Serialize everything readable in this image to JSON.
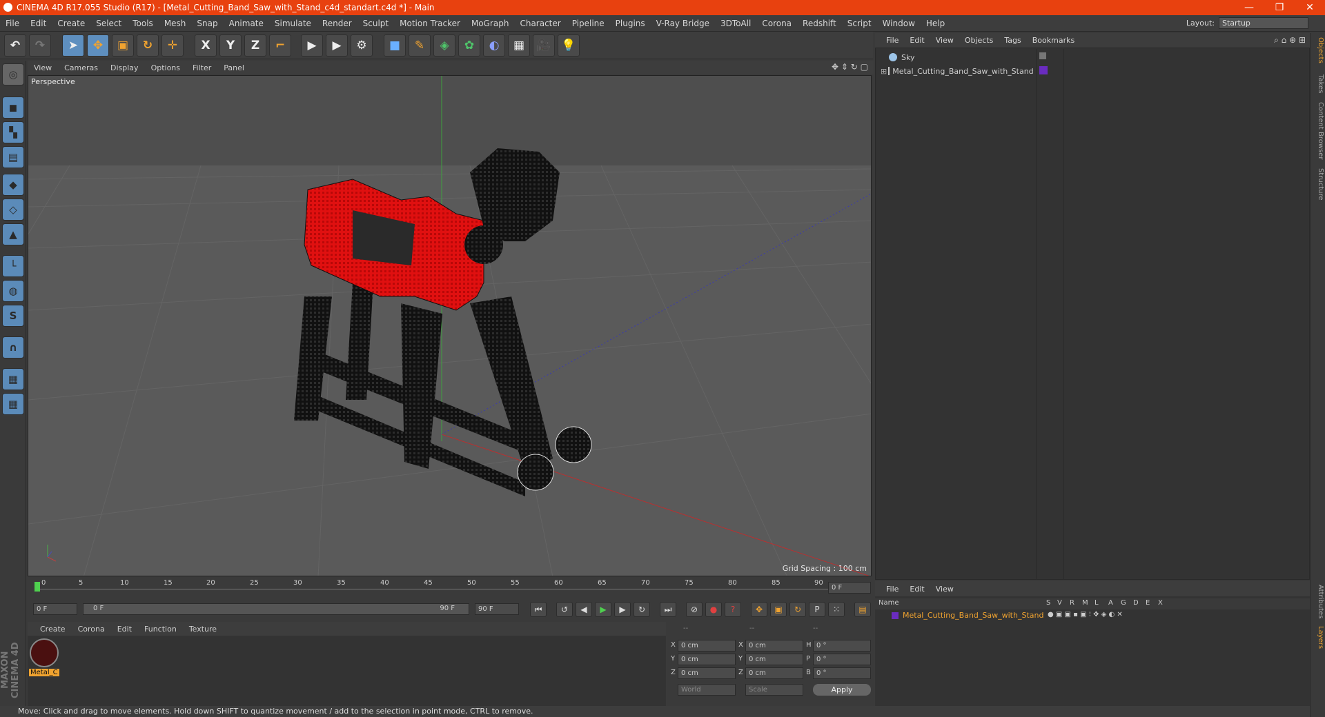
{
  "title": "CINEMA 4D R17.055 Studio (R17) - [Metal_Cutting_Band_Saw_with_Stand_c4d_standart.c4d *] - Main",
  "window_controls": {
    "minimize": "—",
    "restore": "❐",
    "close": "✕"
  },
  "menu": [
    "File",
    "Edit",
    "Create",
    "Select",
    "Tools",
    "Mesh",
    "Snap",
    "Animate",
    "Simulate",
    "Render",
    "Sculpt",
    "Motion Tracker",
    "MoGraph",
    "Character",
    "Pipeline",
    "Plugins",
    "V-Ray Bridge",
    "3DToAll",
    "Corona",
    "Redshift",
    "Script",
    "Window",
    "Help"
  ],
  "layout": {
    "label": "Layout:",
    "value": "Startup"
  },
  "toolbar_icons": [
    "undo-icon",
    "redo-icon",
    "select-icon",
    "move-icon",
    "scale-icon",
    "rotate-icon",
    "live-selection-icon",
    "x-axis-icon",
    "y-axis-icon",
    "z-axis-icon",
    "coordinate-system-icon",
    "render-view-icon",
    "render-picture-viewer-icon",
    "edit-render-settings-icon",
    "cube-icon",
    "pen-icon",
    "subdivision-icon",
    "cloner-icon",
    "deformer-icon",
    "floor-icon",
    "camera-icon",
    "light-icon"
  ],
  "axis_labels": {
    "x": "X",
    "y": "Y",
    "z": "Z"
  },
  "viewport": {
    "menu": [
      "View",
      "Cameras",
      "Display",
      "Options",
      "Filter",
      "Panel"
    ],
    "label": "Perspective",
    "grid_spacing": "Grid Spacing : 100 cm"
  },
  "objects": {
    "menu": [
      "File",
      "Edit",
      "View",
      "Objects",
      "Tags",
      "Bookmarks"
    ],
    "items": [
      "Sky",
      "Metal_Cutting_Band_Saw_with_Stand"
    ]
  },
  "right_tabs": [
    "Objects",
    "Takes",
    "Content Browser",
    "Structure"
  ],
  "right_tabs_bottom": [
    "Attributes",
    "Layers"
  ],
  "timeline": {
    "ticks": [
      "0",
      "5",
      "10",
      "15",
      "20",
      "25",
      "30",
      "35",
      "40",
      "45",
      "50",
      "55",
      "60",
      "65",
      "70",
      "75",
      "80",
      "85",
      "90"
    ],
    "current": "0 F",
    "start": "0 F",
    "range_start": "0 F",
    "range_end": "90 F",
    "end": "90 F"
  },
  "material": {
    "menu": [
      "Create",
      "Corona",
      "Edit",
      "Function",
      "Texture"
    ],
    "name": "Metal_C"
  },
  "coords": {
    "headers": [
      "--",
      "--",
      "--"
    ],
    "rows": [
      {
        "a": "X",
        "av": "0 cm",
        "b": "X",
        "bv": "0 cm",
        "c": "H",
        "cv": "0 °"
      },
      {
        "a": "Y",
        "av": "0 cm",
        "b": "Y",
        "bv": "0 cm",
        "c": "P",
        "cv": "0 °"
      },
      {
        "a": "Z",
        "av": "0 cm",
        "b": "Z",
        "bv": "0 cm",
        "c": "B",
        "cv": "0 °"
      }
    ],
    "mode": "World",
    "scale": "Scale",
    "apply": "Apply"
  },
  "layers": {
    "menu": [
      "File",
      "Edit",
      "View"
    ],
    "name_header": "Name",
    "cols": [
      "S",
      "V",
      "R",
      "M",
      "L",
      "A",
      "G",
      "D",
      "E",
      "X"
    ],
    "item": "Metal_Cutting_Band_Saw_with_Stand"
  },
  "brand": "MAXON CINEMA 4D",
  "status": "Move: Click and drag to move elements. Hold down SHIFT to quantize movement / add to the selection in point mode, CTRL to remove.",
  "colors": {
    "titlebar": "#e8410f",
    "accent_blue": "#5b8bb9",
    "saw_red": "#e01010",
    "object_orange": "#f0a330"
  }
}
